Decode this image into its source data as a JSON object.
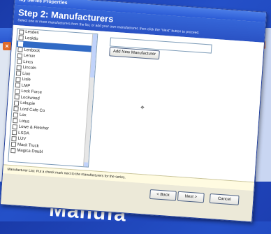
{
  "window": {
    "title": "My Series Properties"
  },
  "header": {
    "step_title": "Step 2: Manufacturers",
    "instructions": "Select one or more manufacturers from the list, or add your own manufacturer, then click the \"Next\" button to proceed."
  },
  "manufacturers": [
    {
      "label": "Lesdes",
      "selected": false
    },
    {
      "label": "Lesktlo",
      "selected": false
    },
    {
      "label": "",
      "selected": true
    },
    {
      "label": "Lenbock",
      "selected": false
    },
    {
      "label": "Lenux",
      "selected": false
    },
    {
      "label": "Lincs",
      "selected": false
    },
    {
      "label": "Lincoln",
      "selected": false
    },
    {
      "label": "Lion",
      "selected": false
    },
    {
      "label": "Lisle",
      "selected": false
    },
    {
      "label": "LMP",
      "selected": false
    },
    {
      "label": "Lock Force",
      "selected": false
    },
    {
      "label": "Lockwood",
      "selected": false
    },
    {
      "label": "Lokupie",
      "selected": false
    },
    {
      "label": "Lord Cafe Co",
      "selected": false
    },
    {
      "label": "Lox",
      "selected": false
    },
    {
      "label": "Lotus",
      "selected": false
    },
    {
      "label": "Lowe & Fletcher",
      "selected": false
    },
    {
      "label": "LSDA",
      "selected": false
    },
    {
      "label": "LUV",
      "selected": false
    },
    {
      "label": "Mack Truck",
      "selected": false
    },
    {
      "label": "Magica Doubl",
      "selected": false
    }
  ],
  "add_manufacturer": {
    "input_value": "",
    "button_label": "Add New Manufacturer"
  },
  "info_text": "Manufacturer List: Put a check mark next to the manufacturers for the series.",
  "buttons": {
    "back": "< Back",
    "next": "Next >",
    "cancel": "Cancel"
  },
  "background": {
    "banner_text": "Manufa"
  },
  "colors": {
    "title_blue": "#2b5bd6",
    "selection": "#316ac5",
    "info_bg": "#fffbe1"
  }
}
